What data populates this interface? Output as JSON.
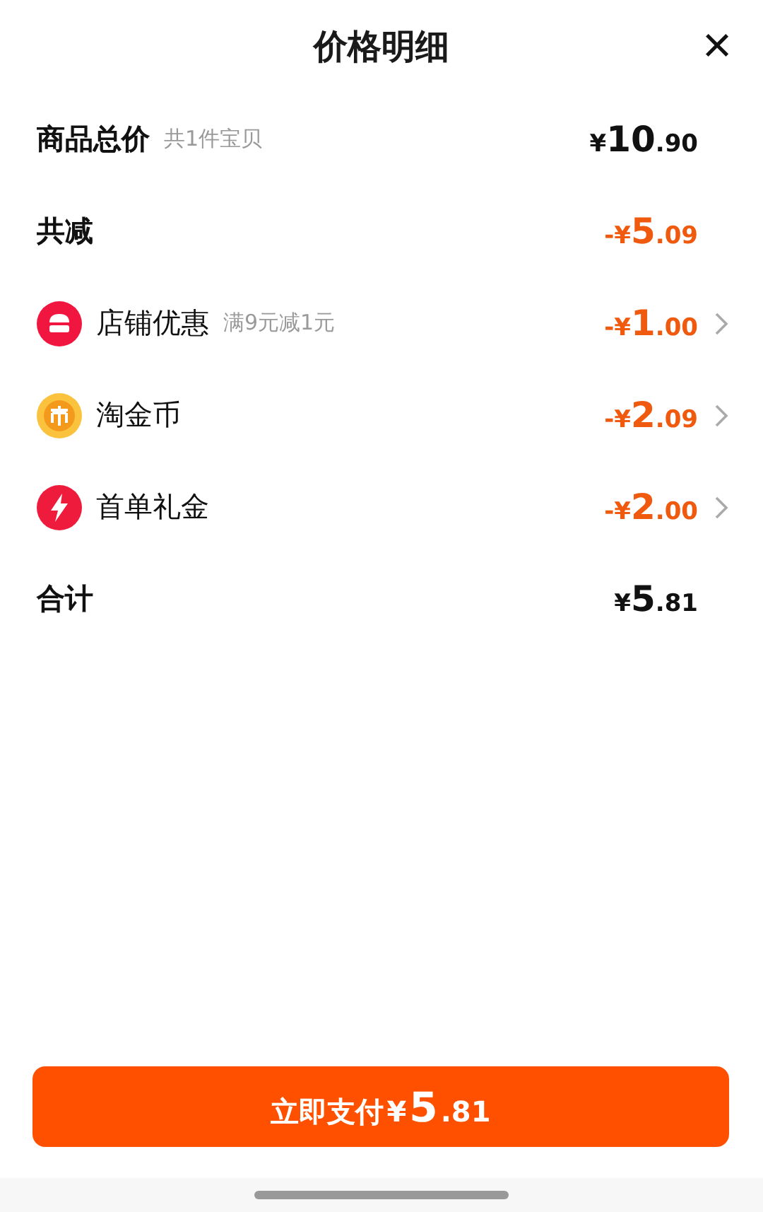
{
  "header": {
    "title": "价格明细",
    "close": "×"
  },
  "rows": [
    {
      "kind": "summary",
      "label": "商品总价",
      "note": "共1件宝贝",
      "price": "¥10.90"
    },
    {
      "kind": "discount_total",
      "label": "共减",
      "price": "-¥5.09"
    },
    {
      "kind": "shop",
      "label": "店铺优惠",
      "note": "满9元减1元",
      "price": "-¥1.00"
    },
    {
      "kind": "coin",
      "label": "淘金币",
      "price": "-¥2.09"
    },
    {
      "kind": "bolt",
      "label": "首单礼金",
      "price": "-¥2.00"
    },
    {
      "kind": "summary",
      "label": "合计",
      "price": "¥5.81"
    }
  ],
  "pay_button": {
    "label": "立即支付",
    "price": "¥5.81"
  }
}
